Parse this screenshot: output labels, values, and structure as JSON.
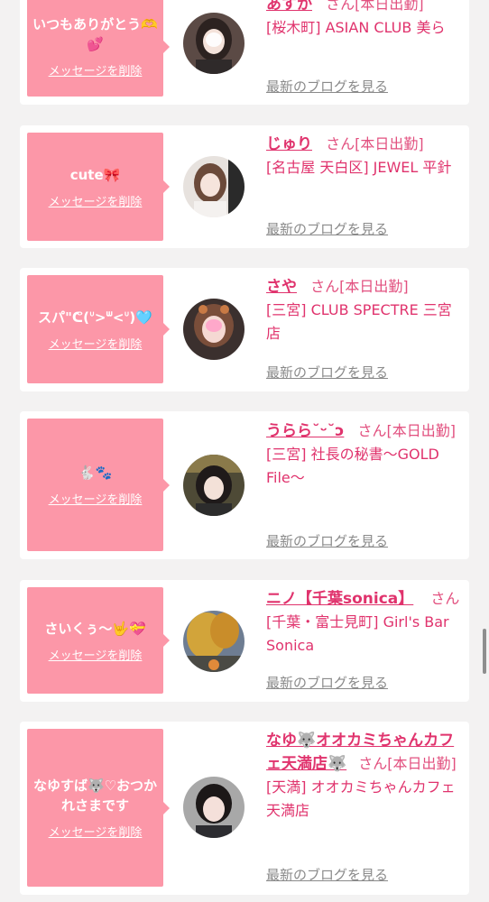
{
  "colors": {
    "background": "#f3f2f2",
    "card": "#ffffff",
    "bubble": "#fc97a8",
    "accent": "#e0336d",
    "muted": "#8a8a8a"
  },
  "cards": [
    {
      "message": "いつもありがとう🫶💕",
      "delete_label": "メッセージを削除",
      "name": "あすか",
      "suffix": "さん[本日出勤]",
      "shop": "[桜木町] ASIAN CLUB 美ら",
      "blog_label": "最新のブログを見る"
    },
    {
      "message": "cute🎀",
      "delete_label": "メッセージを削除",
      "name": "じゅり",
      "suffix": "さん[本日出勤]",
      "shop": "[名古屋 天白区] JEWEL 平針",
      "blog_label": "最新のブログを見る"
    },
    {
      "message": "スパ\"ᕦ(ᐡ>ᐜ<ᐡ)🩵",
      "delete_label": "メッセージを削除",
      "name": "さや",
      "suffix": "さん[本日出勤]",
      "shop": "[三宮] CLUB SPECTRE 三宮店",
      "blog_label": "最新のブログを見る"
    },
    {
      "message": "🐇🐾",
      "delete_label": "メッセージを削除",
      "name": "うらら˘ᵕ˘ↄ",
      "suffix": "さん[本日出勤]",
      "shop": "[三宮] 社長の秘書〜GOLD File〜",
      "blog_label": "最新のブログを見る"
    },
    {
      "message": "さいくぅ〜🤟💝",
      "delete_label": "メッセージを削除",
      "name": "ニノ【千葉sonica】",
      "suffix": "さん",
      "shop": "[千葉・富士見町] Girl's Bar Sonica",
      "blog_label": "最新のブログを見る"
    },
    {
      "message": "なゆすば🐺♡おつかれさまです",
      "delete_label": "メッセージを削除",
      "name": "なゆ🐺オオカミちゃんカフェ天満店🐺",
      "suffix": "さん[本日出勤]",
      "shop": "[天満] オオカミちゃんカフェ天満店",
      "blog_label": "最新のブログを見る"
    }
  ]
}
